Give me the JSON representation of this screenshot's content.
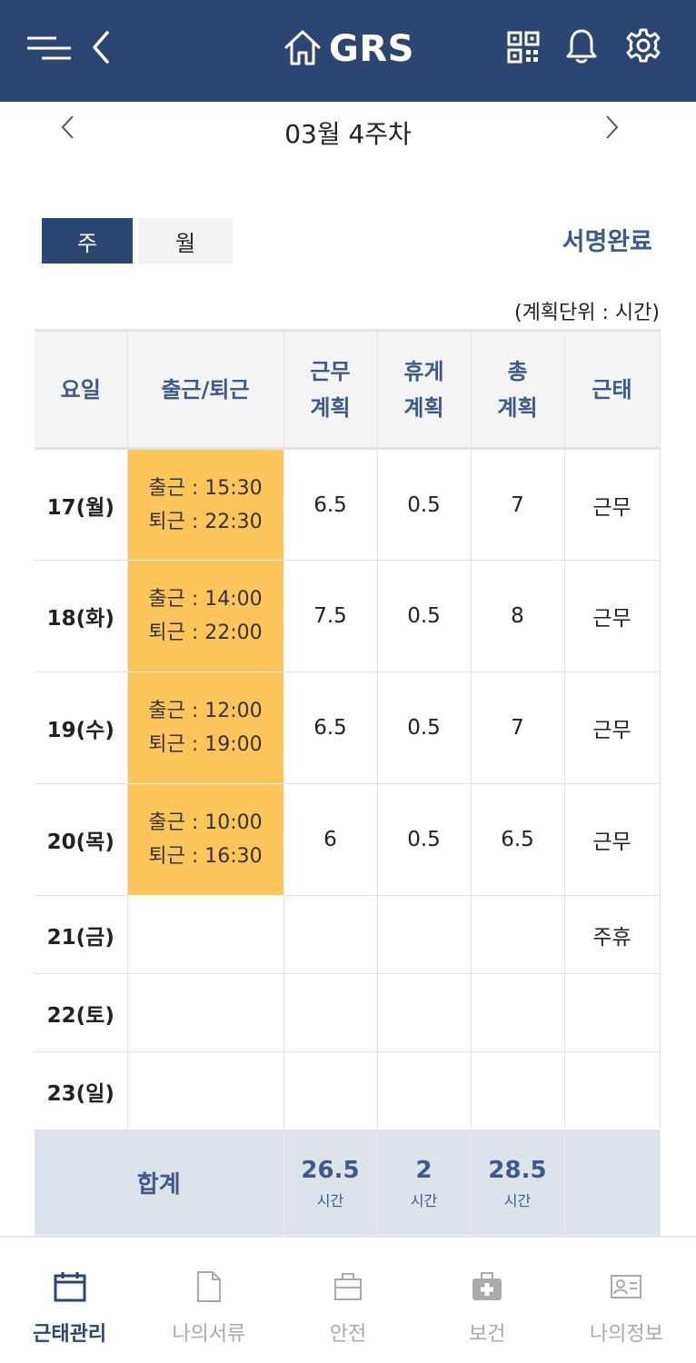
{
  "header": {
    "brand": "GRS"
  },
  "week_nav": {
    "title": "03월 4주차"
  },
  "toggle": {
    "week": "주",
    "month": "월"
  },
  "sign_status": "서명완료",
  "unit_note": "(계획단위 : 시간)",
  "table": {
    "headers": {
      "day": "요일",
      "inout": "출근/퇴근",
      "work_line1": "근무",
      "work_line2": "계획",
      "rest_line1": "휴게",
      "rest_line2": "계획",
      "total_line1": "총",
      "total_line2": "계획",
      "status": "근태"
    },
    "rows": [
      {
        "day": "17(월)",
        "in": "출근 : 15:30",
        "out": "퇴근 : 22:30",
        "work": "6.5",
        "rest": "0.5",
        "total": "7",
        "status": "근무"
      },
      {
        "day": "18(화)",
        "in": "출근 : 14:00",
        "out": "퇴근 : 22:00",
        "work": "7.5",
        "rest": "0.5",
        "total": "8",
        "status": "근무"
      },
      {
        "day": "19(수)",
        "in": "출근 : 12:00",
        "out": "퇴근 : 19:00",
        "work": "6.5",
        "rest": "0.5",
        "total": "7",
        "status": "근무"
      },
      {
        "day": "20(목)",
        "in": "출근 : 10:00",
        "out": "퇴근 : 16:30",
        "work": "6",
        "rest": "0.5",
        "total": "6.5",
        "status": "근무"
      },
      {
        "day": "21(금)",
        "status": "주휴"
      },
      {
        "day": "22(토)"
      },
      {
        "day": "23(일)"
      }
    ],
    "totals": {
      "label": "합계",
      "work": "26.5",
      "rest": "2",
      "total": "28.5",
      "unit": "시간"
    }
  },
  "bottom_nav": [
    {
      "label": "근태관리",
      "icon": "calendar-icon",
      "active": true
    },
    {
      "label": "나의서류",
      "icon": "document-icon"
    },
    {
      "label": "안전",
      "icon": "briefcase-icon"
    },
    {
      "label": "보건",
      "icon": "medical-kit-icon"
    },
    {
      "label": "나의정보",
      "icon": "id-card-icon"
    }
  ],
  "colors": {
    "primary": "#2b4670",
    "accent_text": "#3d5a8a",
    "time_cell": "#fec55a",
    "total_row": "#dde3ea"
  }
}
